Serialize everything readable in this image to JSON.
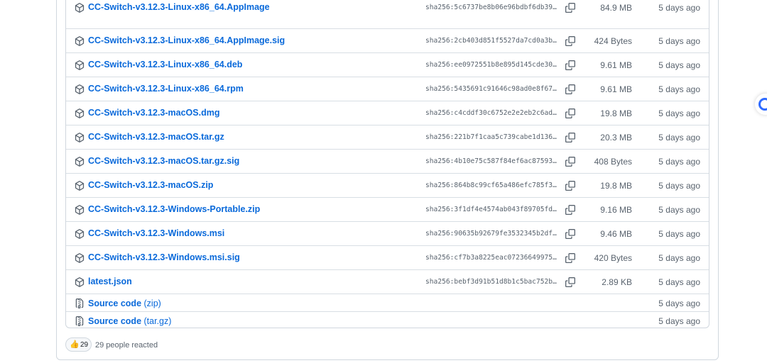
{
  "assets": [
    {
      "name": "CC-Switch-v3.12.3-Linux-x86_64.AppImage",
      "sha": "sha256:5c6737be8b06e96bdbf6db391…",
      "size": "84.9 MB",
      "date": "5 days ago"
    },
    {
      "name": "CC-Switch-v3.12.3-Linux-x86_64.AppImage.sig",
      "sha": "sha256:2cb403d851f5527da7cd0a3be…",
      "size": "424 Bytes",
      "date": "5 days ago"
    },
    {
      "name": "CC-Switch-v3.12.3-Linux-x86_64.deb",
      "sha": "sha256:ee0972551b8e895d145cde303…",
      "size": "9.61 MB",
      "date": "5 days ago"
    },
    {
      "name": "CC-Switch-v3.12.3-Linux-x86_64.rpm",
      "sha": "sha256:5435691c91646c98ad0e8f674…",
      "size": "9.61 MB",
      "date": "5 days ago"
    },
    {
      "name": "CC-Switch-v3.12.3-macOS.dmg",
      "sha": "sha256:c4cddf30c6752e2e2eb2c6ade…",
      "size": "19.8 MB",
      "date": "5 days ago"
    },
    {
      "name": "CC-Switch-v3.12.3-macOS.tar.gz",
      "sha": "sha256:221b7f1caa5c739cabe1d1360…",
      "size": "20.3 MB",
      "date": "5 days ago"
    },
    {
      "name": "CC-Switch-v3.12.3-macOS.tar.gz.sig",
      "sha": "sha256:4b10e75c587f84ef6ac87593e…",
      "size": "408 Bytes",
      "date": "5 days ago"
    },
    {
      "name": "CC-Switch-v3.12.3-macOS.zip",
      "sha": "sha256:864b8c99cf65a486efc785f32…",
      "size": "19.8 MB",
      "date": "5 days ago"
    },
    {
      "name": "CC-Switch-v3.12.3-Windows-Portable.zip",
      "sha": "sha256:3f1df4e4574ab043f89705fd9…",
      "size": "9.16 MB",
      "date": "5 days ago"
    },
    {
      "name": "CC-Switch-v3.12.3-Windows.msi",
      "sha": "sha256:90635b92679fe3532345b2dff…",
      "size": "9.46 MB",
      "date": "5 days ago"
    },
    {
      "name": "CC-Switch-v3.12.3-Windows.msi.sig",
      "sha": "sha256:cf7b3a8225eac072366499756…",
      "size": "420 Bytes",
      "date": "5 days ago"
    },
    {
      "name": "latest.json",
      "sha": "sha256:bebf3d91b51d8b1c5bac752bf…",
      "size": "2.89 KB",
      "date": "5 days ago"
    }
  ],
  "source_code": [
    {
      "name": "Source code",
      "ext": "(zip)",
      "date": "5 days ago"
    },
    {
      "name": "Source code",
      "ext": "(tar.gz)",
      "date": "5 days ago"
    }
  ],
  "reactions": {
    "emoji": "👍",
    "count": "29",
    "text": "29 people reacted"
  },
  "colors": {
    "link": "#0969da",
    "muted": "#59636e",
    "border": "#d0d7de",
    "floating_accent": "#2f6bff"
  }
}
